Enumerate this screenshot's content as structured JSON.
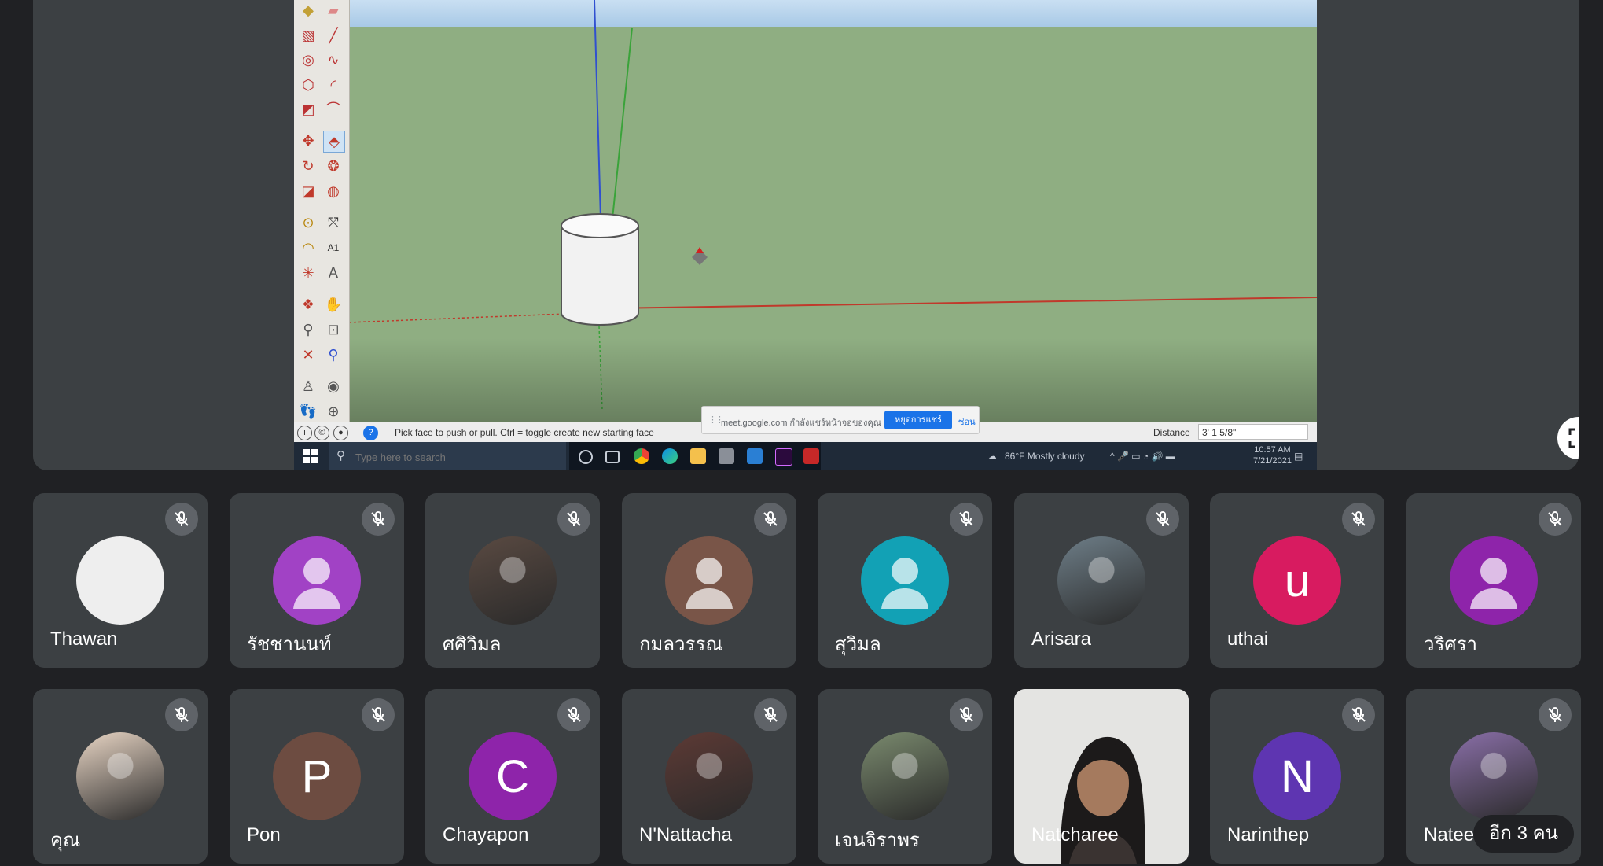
{
  "shared_screen": {
    "status_hint": "Pick face to push or pull.  Ctrl = toggle create new starting face",
    "distance_label": "Distance",
    "distance_value": "3' 1 5/8\"",
    "share_notice": {
      "text": "meet.google.com กำลังแชร์หน้าจอของคุณ",
      "stop_label": "หยุดการแชร์",
      "hide_label": "ซ่อน"
    },
    "taskbar": {
      "search_placeholder": "Type here to search",
      "weather": "86°F  Mostly cloudy",
      "time": "10:57 AM",
      "date": "7/21/2021"
    }
  },
  "participants": [
    {
      "name": "Thawan",
      "avatar_type": "blank",
      "color": "#eeeeee",
      "muted": true
    },
    {
      "name": "รัชชานนท์",
      "avatar_type": "person",
      "color": "#a142c5",
      "muted": true
    },
    {
      "name": "ศศิวิมล",
      "avatar_type": "photo",
      "color": "#5a4a42",
      "muted": true
    },
    {
      "name": "กมลวรรณ",
      "avatar_type": "person",
      "color": "#795548",
      "muted": true
    },
    {
      "name": "สุวิมล",
      "avatar_type": "person",
      "color": "#12a1b5",
      "muted": true
    },
    {
      "name": "Arisara",
      "avatar_type": "photo",
      "color": "#6e7e88",
      "muted": true
    },
    {
      "name": "uthai",
      "avatar_type": "letter",
      "letter": "u",
      "color": "#d81b60",
      "muted": true
    },
    {
      "name": "วริศรา",
      "avatar_type": "person",
      "color": "#8e24aa",
      "muted": true
    },
    {
      "name": "คุณ",
      "avatar_type": "photo",
      "color": "#e8d5c4",
      "muted": true
    },
    {
      "name": "Pon",
      "avatar_type": "letter",
      "letter": "P",
      "color": "#6d4c41",
      "muted": true
    },
    {
      "name": "Chayapon",
      "avatar_type": "letter",
      "letter": "C",
      "color": "#8e24aa",
      "muted": true
    },
    {
      "name": "N'Nattacha",
      "avatar_type": "photo",
      "color": "#5d3a35",
      "muted": true
    },
    {
      "name": "เจนจิราพร",
      "avatar_type": "photo",
      "color": "#7a8a6e",
      "muted": true
    },
    {
      "name": "Natcharee",
      "avatar_type": "video",
      "color": "#e6e6e6",
      "muted": false
    },
    {
      "name": "Narinthep",
      "avatar_type": "letter",
      "letter": "N",
      "color": "#5e35b1",
      "muted": true
    },
    {
      "name": "Natee",
      "avatar_type": "photo",
      "color": "#8a6fa8",
      "muted": true
    }
  ],
  "more_label": "อีก 3 คน"
}
